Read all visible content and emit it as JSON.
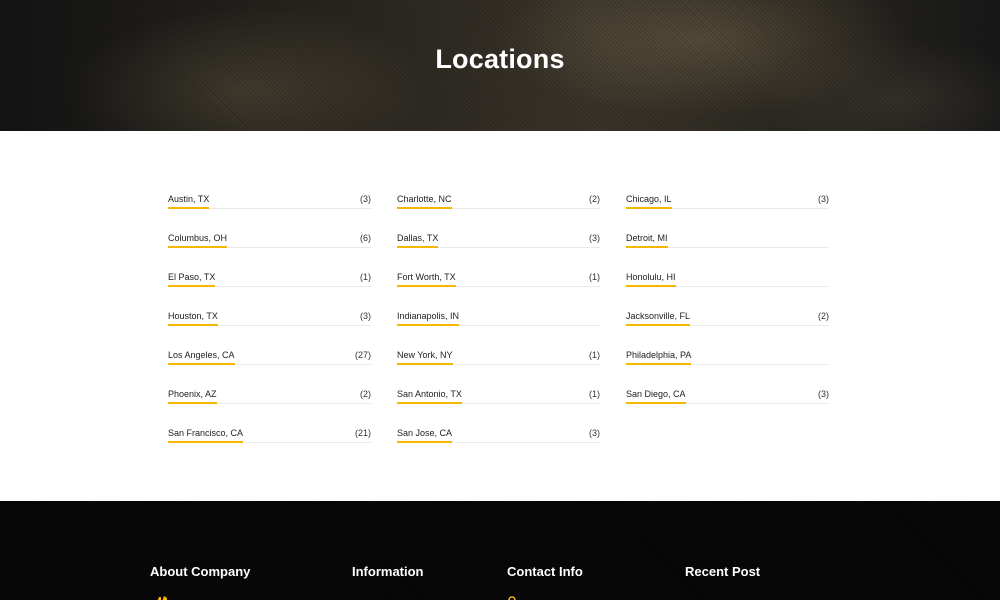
{
  "hero": {
    "title": "Locations"
  },
  "locations": [
    [
      {
        "name": "Austin, TX",
        "count": "(3)"
      },
      {
        "name": "Columbus, OH",
        "count": "(6)"
      },
      {
        "name": "El Paso, TX",
        "count": "(1)"
      },
      {
        "name": "Houston, TX",
        "count": "(3)"
      },
      {
        "name": "Los Angeles, CA",
        "count": "(27)"
      },
      {
        "name": "Phoenix, AZ",
        "count": "(2)"
      },
      {
        "name": "San Francisco, CA",
        "count": "(21)"
      }
    ],
    [
      {
        "name": "Charlotte, NC",
        "count": "(2)"
      },
      {
        "name": "Dallas, TX",
        "count": "(3)"
      },
      {
        "name": "Fort Worth, TX",
        "count": "(1)"
      },
      {
        "name": "Indianapolis, IN",
        "count": ""
      },
      {
        "name": "New York, NY",
        "count": "(1)"
      },
      {
        "name": "San Antonio, TX",
        "count": "(1)"
      },
      {
        "name": "San Jose, CA",
        "count": "(3)"
      }
    ],
    [
      {
        "name": "Chicago, IL",
        "count": "(3)"
      },
      {
        "name": "Detroit, MI",
        "count": ""
      },
      {
        "name": "Honolulu, HI",
        "count": ""
      },
      {
        "name": "Jacksonville, FL",
        "count": "(2)"
      },
      {
        "name": "Philadelphia, PA",
        "count": ""
      },
      {
        "name": "San Diego, CA",
        "count": "(3)"
      }
    ]
  ],
  "footer": {
    "about_heading": "About Company",
    "information_heading": "Information",
    "contact_heading": "Contact Info",
    "recent_heading": "Recent Post",
    "logo_icon": "crane-logo-icon",
    "contact_icon": "map-pin-icon"
  },
  "colors": {
    "accent": "#f5b700",
    "footer_bg": "#050505",
    "text": "#222222"
  }
}
